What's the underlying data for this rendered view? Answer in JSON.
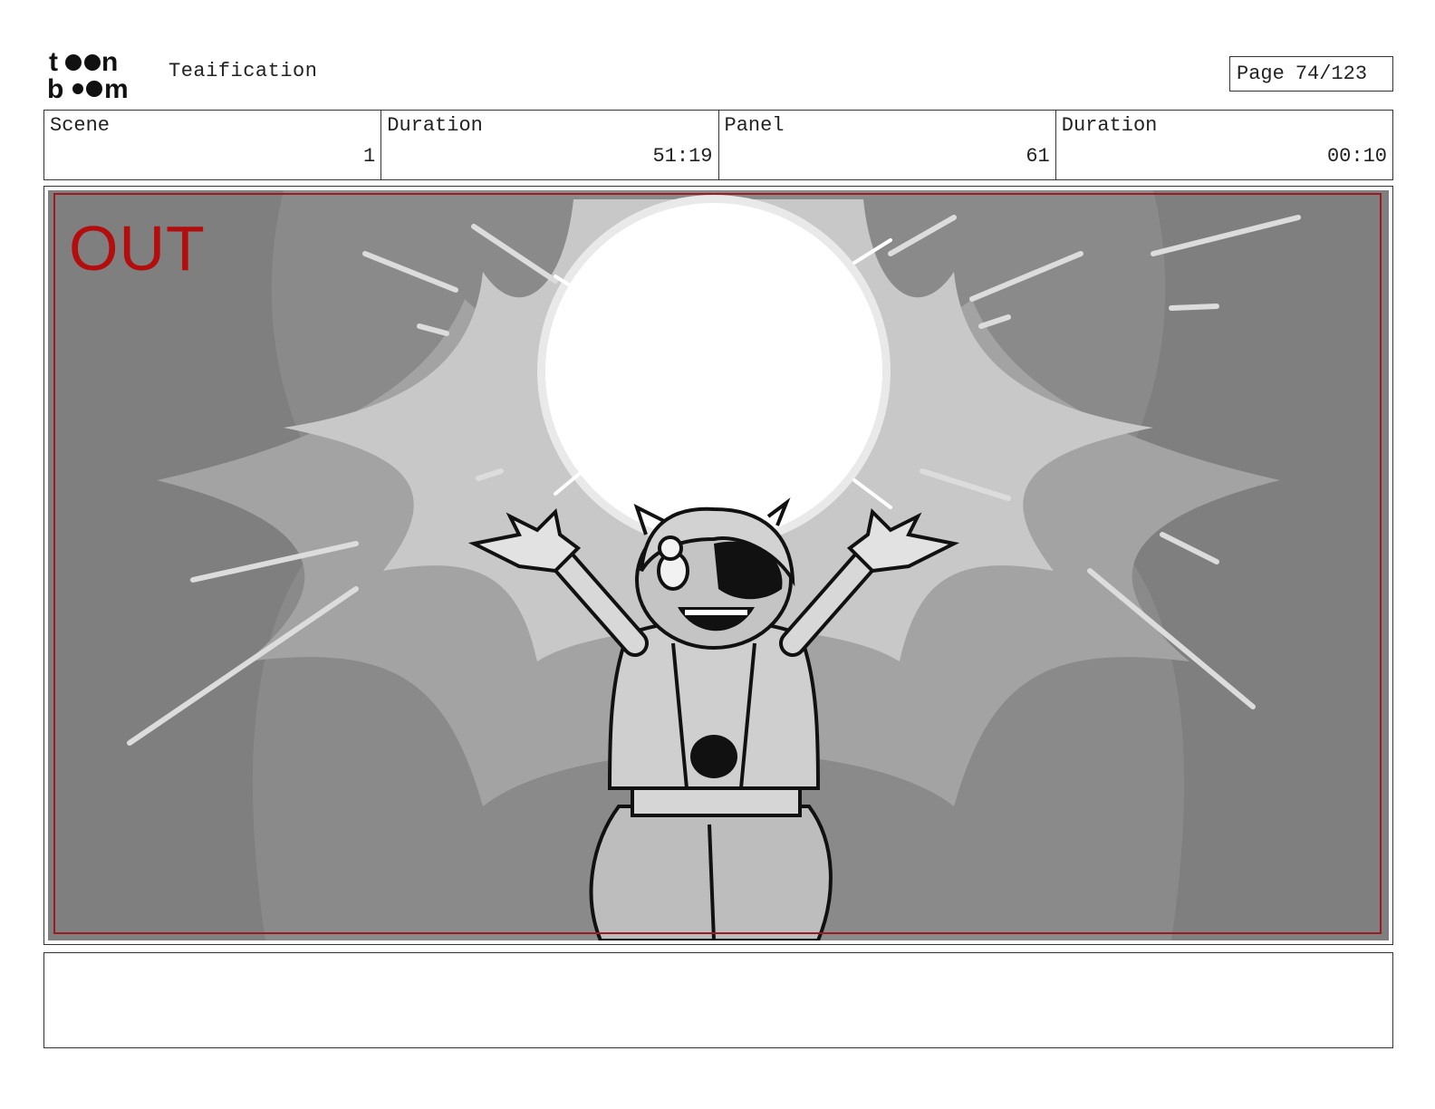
{
  "header": {
    "logo_text": "toon boom",
    "project_title": "Teaification",
    "page_label": "Page",
    "page_number": "74/123"
  },
  "info": {
    "scene_label": "Scene",
    "scene_value": "1",
    "scene_duration_label": "Duration",
    "scene_duration_value": "51:19",
    "panel_label": "Panel",
    "panel_value": "61",
    "panel_duration_label": "Duration",
    "panel_duration_value": "00:10"
  },
  "panel": {
    "camera_move_label": "OUT",
    "safe_frame_color": "#9a1c20",
    "out_label_color": "#b30d0d"
  },
  "notes": {
    "text": ""
  }
}
